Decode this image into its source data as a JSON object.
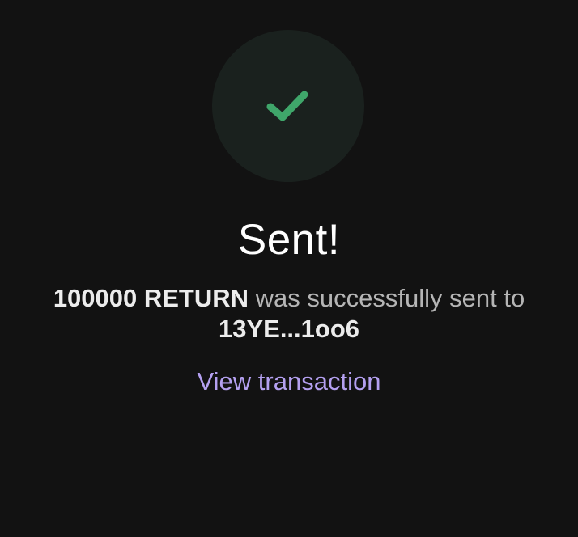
{
  "status": {
    "icon": "checkmark-icon",
    "badge_bg": "#1a211e",
    "check_color": "#3fa66a"
  },
  "title": "Sent!",
  "message": {
    "amount": "100000 RETURN",
    "middle_text": "was successfully sent to",
    "recipient": "13YE...1oo6",
    "muted_color": "#b5b5b5"
  },
  "link": {
    "label": "View transaction",
    "color": "#b4a0f0"
  }
}
